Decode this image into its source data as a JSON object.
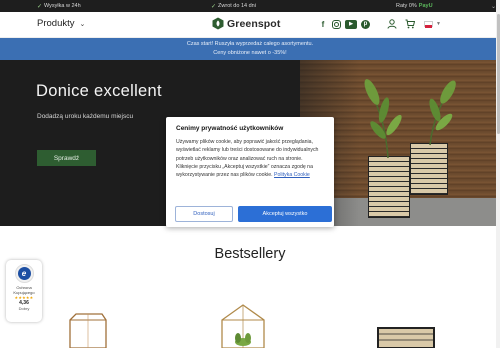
{
  "topbar": {
    "shipping": "Wysyłka w 24h",
    "returns": "Zwrot do 14 dni",
    "raty_prefix": "Raty 0%",
    "raty_brand": "PayU"
  },
  "header": {
    "menu_label": "Produkty",
    "logo_text": "Greenspot",
    "socials": [
      "facebook-icon",
      "instagram-icon",
      "youtube-icon",
      "pinterest-icon"
    ],
    "language": "PL"
  },
  "promo": {
    "line1": "Czas start! Ruszyła wyprzedaż całego asortymentu.",
    "line2": "Ceny obniżone nawet o -35%!"
  },
  "hero": {
    "title": "Donice excellent",
    "subtitle": "Dodadzą uroku każdemu miejscu",
    "button_label": "Sprawdź"
  },
  "bestsellers": {
    "title": "Bestsellery"
  },
  "trust_badge": {
    "line1": "Ochrona Kupującego",
    "stars": "★★★★★",
    "score": "4,36",
    "line3": "Dobry"
  },
  "cookie": {
    "title": "Cenimy prywatność użytkowników",
    "body": "Używamy plików cookie, aby poprawić jakość przeglądania, wyświetlać reklamy lub treści dostosowane do indywidualnych potrzeb użytkowników oraz analizować ruch na stronie. Kliknięcie przycisku „Akceptuj wszystkie” oznacza zgodę na wykorzystywanie przez nas plików cookie.",
    "policy_link": "Polityka Cookie",
    "btn_customize": "Dostosuj",
    "btn_accept_all": "Akceptuj wszystko"
  },
  "colors": {
    "brand_green": "#2e5d31",
    "promo_blue": "#3b6fb3",
    "accept_blue": "#2c6fd6"
  }
}
